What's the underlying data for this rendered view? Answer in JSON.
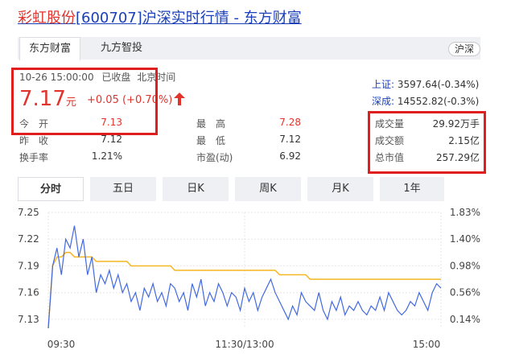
{
  "header": {
    "stock_name": "彩虹股份",
    "stock_code": "[600707]",
    "suffix": "沪深实时行情 - 东方财富"
  },
  "tabs": [
    {
      "label": "东方财富",
      "active": true
    },
    {
      "label": "九方智投",
      "active": false
    }
  ],
  "market_badge": "沪深",
  "quote": {
    "timestamp": "10-26 15:00:00",
    "status": "已收盘",
    "timezone": "北京时间",
    "price": "7.17",
    "currency": "元",
    "change": "+0.05",
    "change_pct": "(+0.70%)"
  },
  "stats": {
    "open_label": "今　开",
    "open_value": "7.13",
    "prev_close_label": "昨　收",
    "prev_close_value": "7.12",
    "turnover_rate_label": "换手率",
    "turnover_rate_value": "1.21%",
    "high_label": "最　高",
    "high_value": "7.28",
    "low_label": "最　低",
    "low_value": "7.12",
    "pe_label": "市盈(动)",
    "pe_value": "6.92"
  },
  "indices": [
    {
      "name": "上证:",
      "value": "3597.64(-0.34%)"
    },
    {
      "name": "深成:",
      "value": "14552.82(-0.3%)"
    }
  ],
  "market_stats": [
    {
      "label": "成交量",
      "value": "29.92万手"
    },
    {
      "label": "成交额",
      "value": "2.15亿"
    },
    {
      "label": "总市值",
      "value": "257.29亿"
    }
  ],
  "periods": [
    {
      "label": "分时",
      "active": true
    },
    {
      "label": "五日",
      "active": false
    },
    {
      "label": "日K",
      "active": false
    },
    {
      "label": "周K",
      "active": false
    },
    {
      "label": "月K",
      "active": false
    },
    {
      "label": "1年",
      "active": false
    }
  ],
  "colors": {
    "price_line": "#4169e1",
    "avg_line": "#f5b623",
    "up": "#e0332c",
    "highlight_box": "#e01e1e"
  },
  "chart_data": {
    "type": "line",
    "y_ticks": [
      "7.25",
      "7.22",
      "7.19",
      "7.16",
      "7.13"
    ],
    "y_pct_ticks": [
      "1.83%",
      "1.40%",
      "0.98%",
      "0.56%",
      "0.14%"
    ],
    "x_ticks": [
      "09:30",
      "11:30/13:00",
      "15:00"
    ],
    "ylim": [
      7.12,
      7.25
    ],
    "series": [
      {
        "key": "price",
        "values": [
          7.12,
          7.19,
          7.21,
          7.18,
          7.22,
          7.21,
          7.235,
          7.2,
          7.22,
          7.18,
          7.2,
          7.16,
          7.18,
          7.17,
          7.185,
          7.165,
          7.18,
          7.16,
          7.17,
          7.15,
          7.16,
          7.14,
          7.165,
          7.155,
          7.17,
          7.15,
          7.16,
          7.145,
          7.17,
          7.165,
          7.15,
          7.16,
          7.14,
          7.17,
          7.155,
          7.175,
          7.145,
          7.16,
          7.15,
          7.17,
          7.16,
          7.145,
          7.16,
          7.155,
          7.14,
          7.165,
          7.15,
          7.16,
          7.14,
          7.155,
          7.165,
          7.175,
          7.16,
          7.15,
          7.14,
          7.13,
          7.145,
          7.135,
          7.16,
          7.15,
          7.145,
          7.14,
          7.16,
          7.14,
          7.13,
          7.15,
          7.14,
          7.155,
          7.135,
          7.145,
          7.14,
          7.15,
          7.14,
          7.135,
          7.145,
          7.14,
          7.155,
          7.14,
          7.16,
          7.15,
          7.14,
          7.135,
          7.14,
          7.15,
          7.145,
          7.16,
          7.15,
          7.14,
          7.16,
          7.17,
          7.165
        ]
      },
      {
        "key": "average",
        "values": [
          7.12,
          7.19,
          7.2,
          7.2,
          7.205,
          7.205,
          7.2,
          7.2,
          7.2,
          7.2,
          7.2,
          7.195,
          7.195,
          7.195,
          7.195,
          7.195,
          7.195,
          7.195,
          7.195,
          7.19,
          7.19,
          7.19,
          7.19,
          7.19,
          7.19,
          7.19,
          7.19,
          7.19,
          7.19,
          7.185,
          7.185,
          7.185,
          7.185,
          7.185,
          7.185,
          7.185,
          7.185,
          7.185,
          7.185,
          7.185,
          7.185,
          7.185,
          7.185,
          7.185,
          7.185,
          7.185,
          7.185,
          7.185,
          7.185,
          7.185,
          7.185,
          7.185,
          7.185,
          7.18,
          7.18,
          7.18,
          7.18,
          7.18,
          7.18,
          7.18,
          7.175,
          7.175,
          7.175,
          7.175,
          7.175,
          7.175,
          7.175,
          7.175,
          7.175,
          7.175,
          7.175,
          7.175,
          7.175,
          7.175,
          7.175,
          7.175,
          7.175,
          7.175,
          7.175,
          7.175,
          7.175,
          7.175,
          7.175,
          7.175,
          7.175,
          7.175,
          7.175,
          7.175,
          7.175,
          7.175,
          7.175
        ]
      }
    ]
  }
}
